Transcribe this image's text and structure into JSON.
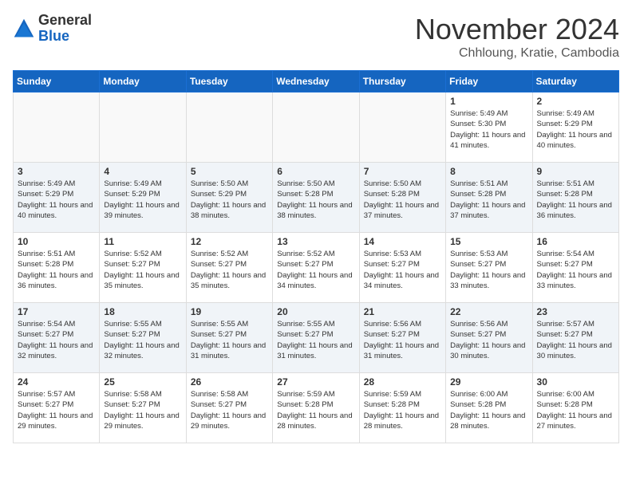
{
  "logo": {
    "general": "General",
    "blue": "Blue"
  },
  "header": {
    "month": "November 2024",
    "location": "Chhloung, Kratie, Cambodia"
  },
  "weekdays": [
    "Sunday",
    "Monday",
    "Tuesday",
    "Wednesday",
    "Thursday",
    "Friday",
    "Saturday"
  ],
  "weeks": [
    [
      {
        "day": "",
        "info": ""
      },
      {
        "day": "",
        "info": ""
      },
      {
        "day": "",
        "info": ""
      },
      {
        "day": "",
        "info": ""
      },
      {
        "day": "",
        "info": ""
      },
      {
        "day": "1",
        "info": "Sunrise: 5:49 AM\nSunset: 5:30 PM\nDaylight: 11 hours and 41 minutes."
      },
      {
        "day": "2",
        "info": "Sunrise: 5:49 AM\nSunset: 5:29 PM\nDaylight: 11 hours and 40 minutes."
      }
    ],
    [
      {
        "day": "3",
        "info": "Sunrise: 5:49 AM\nSunset: 5:29 PM\nDaylight: 11 hours and 40 minutes."
      },
      {
        "day": "4",
        "info": "Sunrise: 5:49 AM\nSunset: 5:29 PM\nDaylight: 11 hours and 39 minutes."
      },
      {
        "day": "5",
        "info": "Sunrise: 5:50 AM\nSunset: 5:29 PM\nDaylight: 11 hours and 38 minutes."
      },
      {
        "day": "6",
        "info": "Sunrise: 5:50 AM\nSunset: 5:28 PM\nDaylight: 11 hours and 38 minutes."
      },
      {
        "day": "7",
        "info": "Sunrise: 5:50 AM\nSunset: 5:28 PM\nDaylight: 11 hours and 37 minutes."
      },
      {
        "day": "8",
        "info": "Sunrise: 5:51 AM\nSunset: 5:28 PM\nDaylight: 11 hours and 37 minutes."
      },
      {
        "day": "9",
        "info": "Sunrise: 5:51 AM\nSunset: 5:28 PM\nDaylight: 11 hours and 36 minutes."
      }
    ],
    [
      {
        "day": "10",
        "info": "Sunrise: 5:51 AM\nSunset: 5:28 PM\nDaylight: 11 hours and 36 minutes."
      },
      {
        "day": "11",
        "info": "Sunrise: 5:52 AM\nSunset: 5:27 PM\nDaylight: 11 hours and 35 minutes."
      },
      {
        "day": "12",
        "info": "Sunrise: 5:52 AM\nSunset: 5:27 PM\nDaylight: 11 hours and 35 minutes."
      },
      {
        "day": "13",
        "info": "Sunrise: 5:52 AM\nSunset: 5:27 PM\nDaylight: 11 hours and 34 minutes."
      },
      {
        "day": "14",
        "info": "Sunrise: 5:53 AM\nSunset: 5:27 PM\nDaylight: 11 hours and 34 minutes."
      },
      {
        "day": "15",
        "info": "Sunrise: 5:53 AM\nSunset: 5:27 PM\nDaylight: 11 hours and 33 minutes."
      },
      {
        "day": "16",
        "info": "Sunrise: 5:54 AM\nSunset: 5:27 PM\nDaylight: 11 hours and 33 minutes."
      }
    ],
    [
      {
        "day": "17",
        "info": "Sunrise: 5:54 AM\nSunset: 5:27 PM\nDaylight: 11 hours and 32 minutes."
      },
      {
        "day": "18",
        "info": "Sunrise: 5:55 AM\nSunset: 5:27 PM\nDaylight: 11 hours and 32 minutes."
      },
      {
        "day": "19",
        "info": "Sunrise: 5:55 AM\nSunset: 5:27 PM\nDaylight: 11 hours and 31 minutes."
      },
      {
        "day": "20",
        "info": "Sunrise: 5:55 AM\nSunset: 5:27 PM\nDaylight: 11 hours and 31 minutes."
      },
      {
        "day": "21",
        "info": "Sunrise: 5:56 AM\nSunset: 5:27 PM\nDaylight: 11 hours and 31 minutes."
      },
      {
        "day": "22",
        "info": "Sunrise: 5:56 AM\nSunset: 5:27 PM\nDaylight: 11 hours and 30 minutes."
      },
      {
        "day": "23",
        "info": "Sunrise: 5:57 AM\nSunset: 5:27 PM\nDaylight: 11 hours and 30 minutes."
      }
    ],
    [
      {
        "day": "24",
        "info": "Sunrise: 5:57 AM\nSunset: 5:27 PM\nDaylight: 11 hours and 29 minutes."
      },
      {
        "day": "25",
        "info": "Sunrise: 5:58 AM\nSunset: 5:27 PM\nDaylight: 11 hours and 29 minutes."
      },
      {
        "day": "26",
        "info": "Sunrise: 5:58 AM\nSunset: 5:27 PM\nDaylight: 11 hours and 29 minutes."
      },
      {
        "day": "27",
        "info": "Sunrise: 5:59 AM\nSunset: 5:28 PM\nDaylight: 11 hours and 28 minutes."
      },
      {
        "day": "28",
        "info": "Sunrise: 5:59 AM\nSunset: 5:28 PM\nDaylight: 11 hours and 28 minutes."
      },
      {
        "day": "29",
        "info": "Sunrise: 6:00 AM\nSunset: 5:28 PM\nDaylight: 11 hours and 28 minutes."
      },
      {
        "day": "30",
        "info": "Sunrise: 6:00 AM\nSunset: 5:28 PM\nDaylight: 11 hours and 27 minutes."
      }
    ]
  ]
}
